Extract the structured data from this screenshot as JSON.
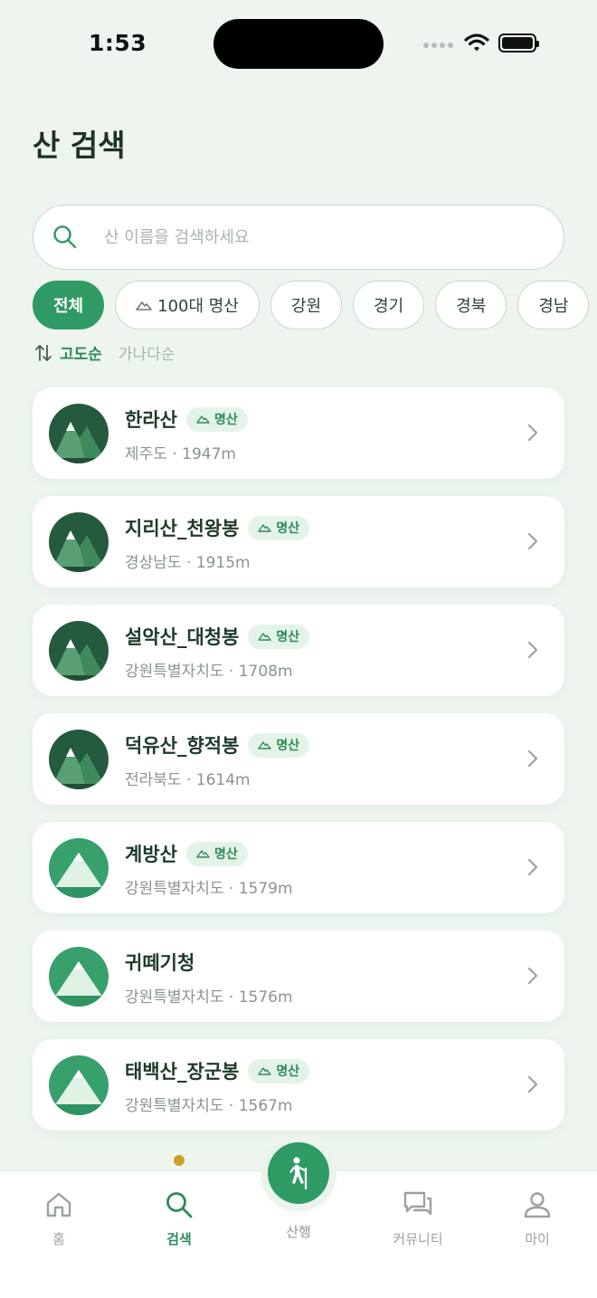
{
  "status_bar": {
    "time": "1:53"
  },
  "page_title": "산 검색",
  "search": {
    "placeholder": "산 이름을 검색하세요",
    "value": ""
  },
  "filters": [
    {
      "label": "전체",
      "active": true,
      "icon": null
    },
    {
      "label": "100대 명산",
      "active": false,
      "icon": "mountain-icon"
    },
    {
      "label": "강원",
      "active": false,
      "icon": null
    },
    {
      "label": "경기",
      "active": false,
      "icon": null
    },
    {
      "label": "경북",
      "active": false,
      "icon": null
    },
    {
      "label": "경남",
      "active": false,
      "icon": null
    },
    {
      "label": "",
      "active": false,
      "icon": null
    }
  ],
  "sort": {
    "active": "고도순",
    "inactive": "가나다순"
  },
  "mountains": [
    {
      "name": "한라산",
      "badge": "명산",
      "region": "제주도",
      "altitude": "1947m",
      "avatar_style": "dark"
    },
    {
      "name": "지리산_천왕봉",
      "badge": "명산",
      "region": "경상남도",
      "altitude": "1915m",
      "avatar_style": "dark"
    },
    {
      "name": "설악산_대청봉",
      "badge": "명산",
      "region": "강원특별자치도",
      "altitude": "1708m",
      "avatar_style": "dark"
    },
    {
      "name": "덕유산_향적봉",
      "badge": "명산",
      "region": "전라북도",
      "altitude": "1614m",
      "avatar_style": "dark"
    },
    {
      "name": "계방산",
      "badge": "명산",
      "region": "강원특별자치도",
      "altitude": "1579m",
      "avatar_style": "light"
    },
    {
      "name": "귀떼기청",
      "badge": "",
      "region": "강원특별자치도",
      "altitude": "1576m",
      "avatar_style": "light"
    },
    {
      "name": "태백산_장군봉",
      "badge": "명산",
      "region": "강원특별자치도",
      "altitude": "1567m",
      "avatar_style": "light"
    }
  ],
  "tab_bar": {
    "home": "홈",
    "search": "검색",
    "hike": "산행",
    "community": "커뮤니티",
    "my": "마이"
  },
  "colors": {
    "accent": "#2f9a63",
    "background": "#eef5ef",
    "indicator": "#c9a227"
  }
}
